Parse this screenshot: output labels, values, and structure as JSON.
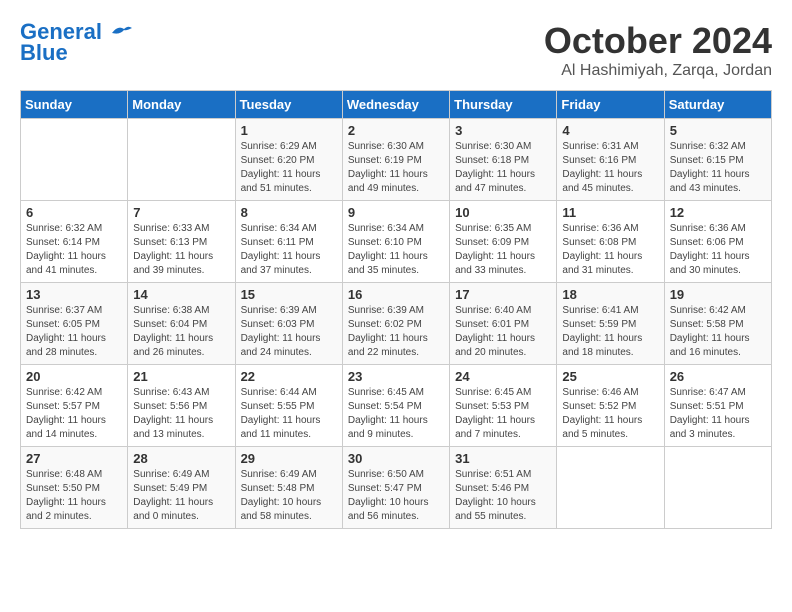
{
  "header": {
    "logo_line1": "General",
    "logo_line2": "Blue",
    "month": "October 2024",
    "location": "Al Hashimiyah, Zarqa, Jordan"
  },
  "weekdays": [
    "Sunday",
    "Monday",
    "Tuesday",
    "Wednesday",
    "Thursday",
    "Friday",
    "Saturday"
  ],
  "weeks": [
    [
      {
        "day": null
      },
      {
        "day": null
      },
      {
        "day": "1",
        "sunrise": "Sunrise: 6:29 AM",
        "sunset": "Sunset: 6:20 PM",
        "daylight": "Daylight: 11 hours and 51 minutes."
      },
      {
        "day": "2",
        "sunrise": "Sunrise: 6:30 AM",
        "sunset": "Sunset: 6:19 PM",
        "daylight": "Daylight: 11 hours and 49 minutes."
      },
      {
        "day": "3",
        "sunrise": "Sunrise: 6:30 AM",
        "sunset": "Sunset: 6:18 PM",
        "daylight": "Daylight: 11 hours and 47 minutes."
      },
      {
        "day": "4",
        "sunrise": "Sunrise: 6:31 AM",
        "sunset": "Sunset: 6:16 PM",
        "daylight": "Daylight: 11 hours and 45 minutes."
      },
      {
        "day": "5",
        "sunrise": "Sunrise: 6:32 AM",
        "sunset": "Sunset: 6:15 PM",
        "daylight": "Daylight: 11 hours and 43 minutes."
      }
    ],
    [
      {
        "day": "6",
        "sunrise": "Sunrise: 6:32 AM",
        "sunset": "Sunset: 6:14 PM",
        "daylight": "Daylight: 11 hours and 41 minutes."
      },
      {
        "day": "7",
        "sunrise": "Sunrise: 6:33 AM",
        "sunset": "Sunset: 6:13 PM",
        "daylight": "Daylight: 11 hours and 39 minutes."
      },
      {
        "day": "8",
        "sunrise": "Sunrise: 6:34 AM",
        "sunset": "Sunset: 6:11 PM",
        "daylight": "Daylight: 11 hours and 37 minutes."
      },
      {
        "day": "9",
        "sunrise": "Sunrise: 6:34 AM",
        "sunset": "Sunset: 6:10 PM",
        "daylight": "Daylight: 11 hours and 35 minutes."
      },
      {
        "day": "10",
        "sunrise": "Sunrise: 6:35 AM",
        "sunset": "Sunset: 6:09 PM",
        "daylight": "Daylight: 11 hours and 33 minutes."
      },
      {
        "day": "11",
        "sunrise": "Sunrise: 6:36 AM",
        "sunset": "Sunset: 6:08 PM",
        "daylight": "Daylight: 11 hours and 31 minutes."
      },
      {
        "day": "12",
        "sunrise": "Sunrise: 6:36 AM",
        "sunset": "Sunset: 6:06 PM",
        "daylight": "Daylight: 11 hours and 30 minutes."
      }
    ],
    [
      {
        "day": "13",
        "sunrise": "Sunrise: 6:37 AM",
        "sunset": "Sunset: 6:05 PM",
        "daylight": "Daylight: 11 hours and 28 minutes."
      },
      {
        "day": "14",
        "sunrise": "Sunrise: 6:38 AM",
        "sunset": "Sunset: 6:04 PM",
        "daylight": "Daylight: 11 hours and 26 minutes."
      },
      {
        "day": "15",
        "sunrise": "Sunrise: 6:39 AM",
        "sunset": "Sunset: 6:03 PM",
        "daylight": "Daylight: 11 hours and 24 minutes."
      },
      {
        "day": "16",
        "sunrise": "Sunrise: 6:39 AM",
        "sunset": "Sunset: 6:02 PM",
        "daylight": "Daylight: 11 hours and 22 minutes."
      },
      {
        "day": "17",
        "sunrise": "Sunrise: 6:40 AM",
        "sunset": "Sunset: 6:01 PM",
        "daylight": "Daylight: 11 hours and 20 minutes."
      },
      {
        "day": "18",
        "sunrise": "Sunrise: 6:41 AM",
        "sunset": "Sunset: 5:59 PM",
        "daylight": "Daylight: 11 hours and 18 minutes."
      },
      {
        "day": "19",
        "sunrise": "Sunrise: 6:42 AM",
        "sunset": "Sunset: 5:58 PM",
        "daylight": "Daylight: 11 hours and 16 minutes."
      }
    ],
    [
      {
        "day": "20",
        "sunrise": "Sunrise: 6:42 AM",
        "sunset": "Sunset: 5:57 PM",
        "daylight": "Daylight: 11 hours and 14 minutes."
      },
      {
        "day": "21",
        "sunrise": "Sunrise: 6:43 AM",
        "sunset": "Sunset: 5:56 PM",
        "daylight": "Daylight: 11 hours and 13 minutes."
      },
      {
        "day": "22",
        "sunrise": "Sunrise: 6:44 AM",
        "sunset": "Sunset: 5:55 PM",
        "daylight": "Daylight: 11 hours and 11 minutes."
      },
      {
        "day": "23",
        "sunrise": "Sunrise: 6:45 AM",
        "sunset": "Sunset: 5:54 PM",
        "daylight": "Daylight: 11 hours and 9 minutes."
      },
      {
        "day": "24",
        "sunrise": "Sunrise: 6:45 AM",
        "sunset": "Sunset: 5:53 PM",
        "daylight": "Daylight: 11 hours and 7 minutes."
      },
      {
        "day": "25",
        "sunrise": "Sunrise: 6:46 AM",
        "sunset": "Sunset: 5:52 PM",
        "daylight": "Daylight: 11 hours and 5 minutes."
      },
      {
        "day": "26",
        "sunrise": "Sunrise: 6:47 AM",
        "sunset": "Sunset: 5:51 PM",
        "daylight": "Daylight: 11 hours and 3 minutes."
      }
    ],
    [
      {
        "day": "27",
        "sunrise": "Sunrise: 6:48 AM",
        "sunset": "Sunset: 5:50 PM",
        "daylight": "Daylight: 11 hours and 2 minutes."
      },
      {
        "day": "28",
        "sunrise": "Sunrise: 6:49 AM",
        "sunset": "Sunset: 5:49 PM",
        "daylight": "Daylight: 11 hours and 0 minutes."
      },
      {
        "day": "29",
        "sunrise": "Sunrise: 6:49 AM",
        "sunset": "Sunset: 5:48 PM",
        "daylight": "Daylight: 10 hours and 58 minutes."
      },
      {
        "day": "30",
        "sunrise": "Sunrise: 6:50 AM",
        "sunset": "Sunset: 5:47 PM",
        "daylight": "Daylight: 10 hours and 56 minutes."
      },
      {
        "day": "31",
        "sunrise": "Sunrise: 6:51 AM",
        "sunset": "Sunset: 5:46 PM",
        "daylight": "Daylight: 10 hours and 55 minutes."
      },
      {
        "day": null
      },
      {
        "day": null
      }
    ]
  ]
}
